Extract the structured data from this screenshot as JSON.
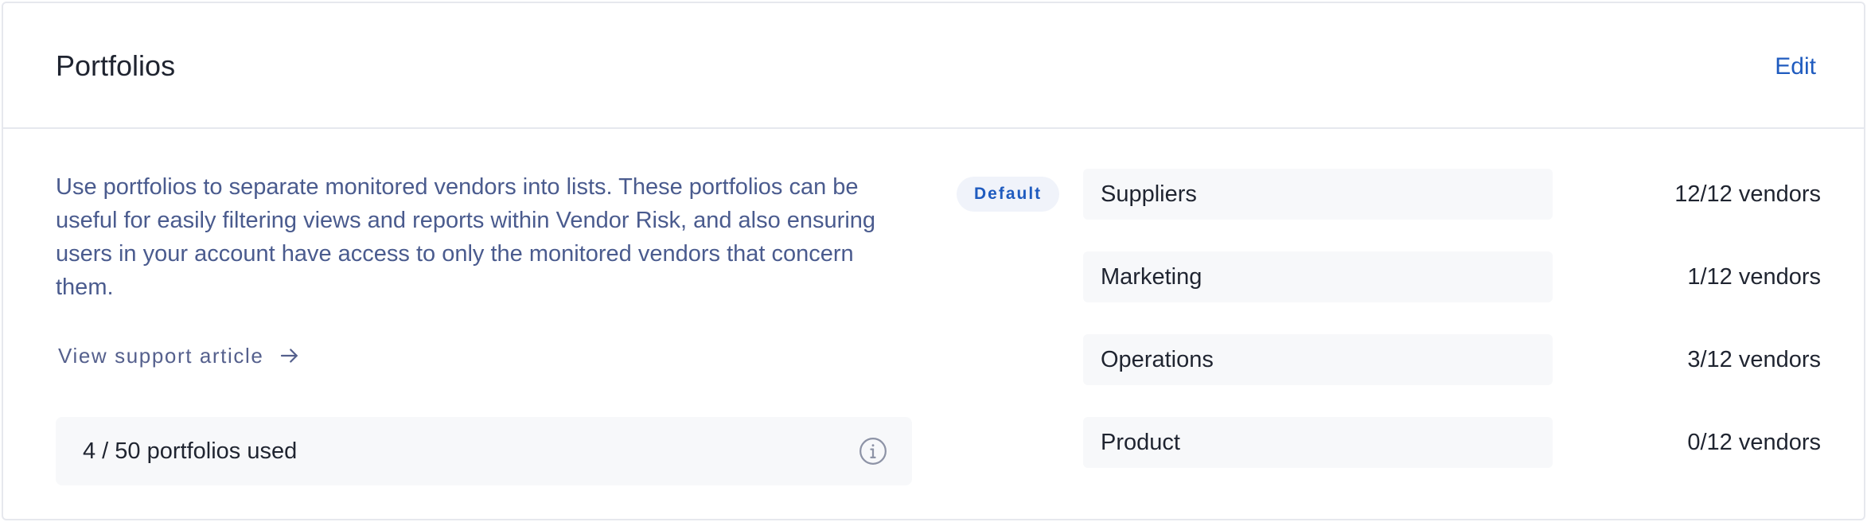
{
  "header": {
    "title": "Portfolios",
    "edit_label": "Edit"
  },
  "intro": {
    "description": "Use portfolios to separate monitored vendors into lists. These portfolios can be useful for easily filtering views and reports within Vendor Risk, and also ensuring users in your account have access to only the monitored vendors that concern them.",
    "support_link": "View support article",
    "support_icon": "arrow-right-icon"
  },
  "usage": {
    "text": "4 / 50 portfolios used",
    "icon": "info-icon"
  },
  "default_badge": "Default",
  "portfolios": [
    {
      "name": "Suppliers",
      "count": "12/12 vendors",
      "is_default": true
    },
    {
      "name": "Marketing",
      "count": "1/12 vendors",
      "is_default": false
    },
    {
      "name": "Operations",
      "count": "3/12 vendors",
      "is_default": false
    },
    {
      "name": "Product",
      "count": "0/12 vendors",
      "is_default": false
    }
  ],
  "colors": {
    "accent": "#1f5bbf",
    "description_text": "#4a5b8e",
    "row_background": "#f7f8fa",
    "badge_background": "#f0f3fa"
  }
}
